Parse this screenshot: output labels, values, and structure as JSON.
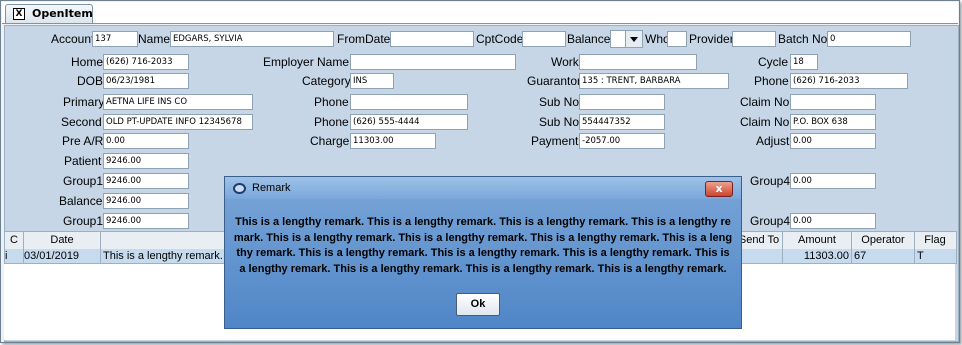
{
  "tab": {
    "title": "OpenItem",
    "close_glyph": "X"
  },
  "header": {
    "account_label": "Account",
    "account": "137",
    "name_label": "Name",
    "name": "EDGARS, SYLVIA",
    "fromdate_label": "FromDate",
    "fromdate": "",
    "cptcode_label": "CptCode",
    "cptcode": "",
    "balance_label": "Balance",
    "balance": "",
    "who_label": "Who",
    "who": "",
    "provider_label": "Provider",
    "provider": "",
    "batch_label": "Batch No.",
    "batch": "0"
  },
  "form": {
    "home_label": "Home",
    "home": "(626) 716-2033",
    "dob_label": "DOB",
    "dob": "06/23/1981",
    "primary_label": "Primary",
    "primary": "AETNA LIFE INS CO",
    "second_label": "Second",
    "second": "OLD PT-UPDATE INFO 12345678",
    "prear_label": "Pre A/R",
    "prear": "0.00",
    "patient_label": "Patient",
    "patient": "9246.00",
    "group1_label": "Group1",
    "group1": "9246.00",
    "balance2_label": "Balance",
    "balance2": "9246.00",
    "group1b_label": "Group1",
    "group1b": "9246.00",
    "employer_label": "Employer Name",
    "employer": "",
    "category_label": "Category",
    "category": "INS",
    "phone1_label": "Phone",
    "phone1": "",
    "phone2_label": "Phone",
    "phone2": "(626) 555-4444",
    "charge_label": "Charge",
    "charge": "11303.00",
    "work_label": "Work",
    "work": "",
    "guarantor_label": "Guarantor",
    "guarantor": "135 : TRENT, BARBARA",
    "subno1_label": "Sub No",
    "subno1": "",
    "subno2_label": "Sub No",
    "subno2": "554447352",
    "payment_label": "Payment",
    "payment": "-2057.00",
    "cycle_label": "Cycle",
    "cycle": "18",
    "phone3_label": "Phone",
    "phone3": "(626) 716-2033",
    "claimno1_label": "Claim No",
    "claimno1": "",
    "claimno2_label": "Claim No",
    "claimno2": "P.O. BOX 638",
    "adjust_label": "Adjust",
    "adjust": "0.00",
    "group4a_label": "Group4",
    "group4a": "0.00",
    "group4b_label": "Group4",
    "group4b": "0.00"
  },
  "table": {
    "headers": {
      "c": "C",
      "date": "Date",
      "sendto": "Send To",
      "amount": "Amount",
      "operator": "Operator",
      "flag": "Flag"
    },
    "rows": [
      {
        "c": "i",
        "date": "03/01/2019",
        "remark": "This is a lengthy remark.",
        "amount": "11303.00",
        "operator": "67",
        "flag": "T"
      }
    ]
  },
  "dialog": {
    "title": "Remark",
    "close_glyph": "x",
    "message": "This is a lengthy remark. This is a lengthy remark. This is a lengthy remark. This is a lengthy remark. This is a lengthy remark. This is a lengthy remark. This is a lengthy remark. This is a lengthy remark. This is a lengthy remark. This is a lengthy remark. This is a lengthy remark. This is a lengthy remark. This is a lengthy remark. This is a lengthy remark. This is a lengthy remark.",
    "ok_label": "Ok"
  },
  "colors": {
    "panel": "#c6d6e6",
    "dialog": "#5a8ed0",
    "selected_row": "#c7dbef"
  }
}
